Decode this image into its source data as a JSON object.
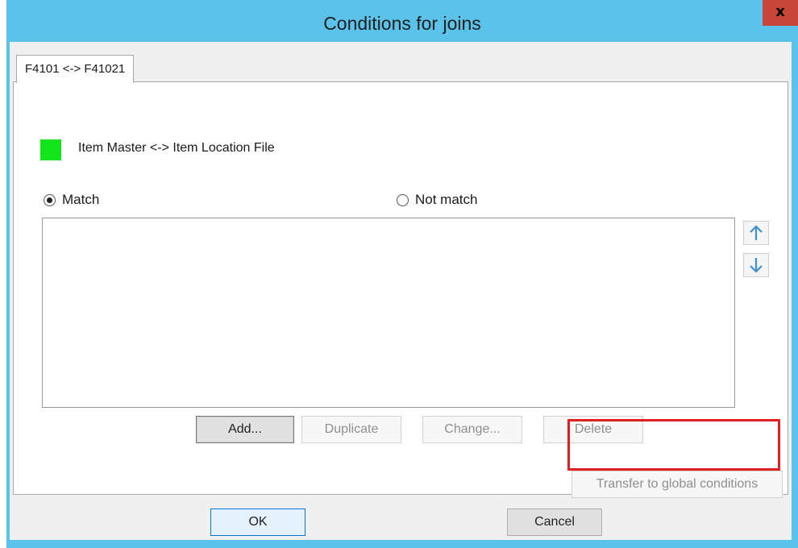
{
  "window": {
    "title": "Conditions for joins",
    "close_label": "x"
  },
  "tab": {
    "label": "F4101 <-> F41021"
  },
  "join": {
    "swatch_color": "#12e51a",
    "title": "Item Master <-> Item Location File"
  },
  "match_options": {
    "match_label": "Match",
    "not_match_label": "Not match",
    "selected": "Match"
  },
  "conditions": [],
  "list_buttons": {
    "add": "Add...",
    "duplicate": "Duplicate",
    "change": "Change...",
    "delete": "Delete"
  },
  "transfer_label": "Transfer to global conditions",
  "dialog_buttons": {
    "ok": "OK",
    "cancel": "Cancel"
  },
  "colors": {
    "titlebar": "#5bc3e9",
    "close": "#c8453a",
    "highlight": "#e02020",
    "arrow": "#3d8fd6"
  }
}
